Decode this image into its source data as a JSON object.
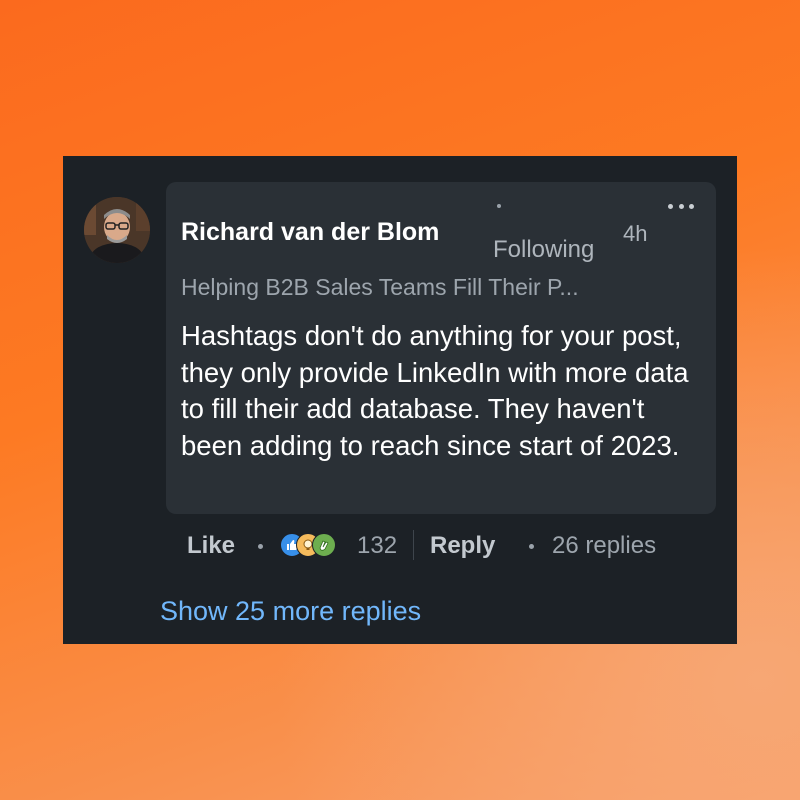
{
  "comment": {
    "author": "Richard van der Blom",
    "follow_status": "Following",
    "time": "4h",
    "headline": "Helping B2B Sales Teams Fill Their P...",
    "text": "Hashtags don't do anything for your post, they only provide LinkedIn with more data to fill their add database. They haven't been adding to reach since start of 2023."
  },
  "actions": {
    "like_label": "Like",
    "reaction_count": "132",
    "reactions": [
      "like-icon",
      "insightful-icon",
      "celebrate-icon"
    ],
    "reply_label": "Reply",
    "replies_label": "26 replies"
  },
  "show_more_label": "Show 25 more replies",
  "colors": {
    "card_bg": "#1c2126",
    "bubble_bg": "#2a3036",
    "link_blue": "#71b7fb",
    "like_blue": "#378fe9",
    "insightful_yellow": "#f5bb5c",
    "celebrate_green": "#6dae4f"
  }
}
